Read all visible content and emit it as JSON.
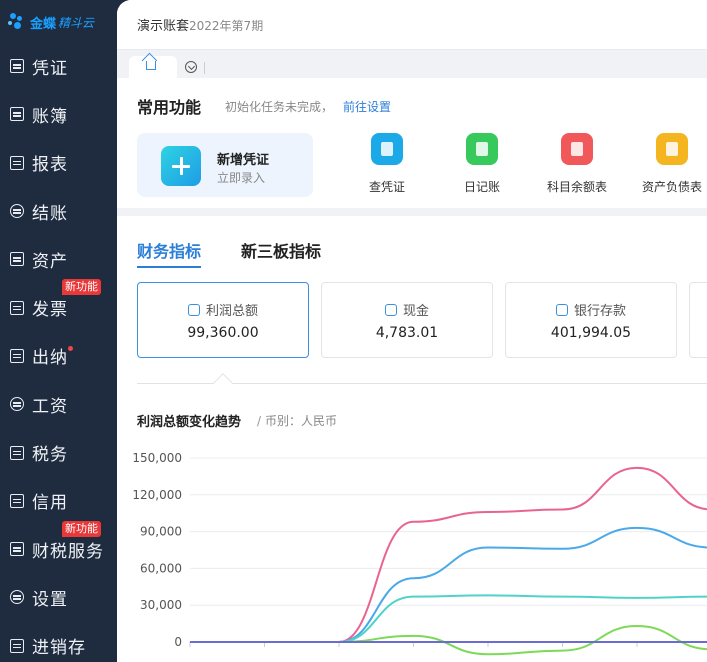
{
  "sidebar": {
    "logo_text": "金蝶",
    "logo_sub": "精斗云",
    "items": [
      {
        "label": "凭证",
        "icon": "voucher-icon"
      },
      {
        "label": "账簿",
        "icon": "ledger-icon"
      },
      {
        "label": "报表",
        "icon": "report-icon"
      },
      {
        "label": "结账",
        "icon": "closing-icon"
      },
      {
        "label": "资产",
        "icon": "asset-icon"
      },
      {
        "label": "发票",
        "icon": "invoice-icon",
        "badge": "新功能"
      },
      {
        "label": "出纳",
        "icon": "cashier-icon",
        "dot": true
      },
      {
        "label": "工资",
        "icon": "salary-icon"
      },
      {
        "label": "税务",
        "icon": "tax-icon"
      },
      {
        "label": "信用",
        "icon": "credit-icon"
      },
      {
        "label": "财税服务",
        "icon": "service-icon",
        "badge": "新功能"
      },
      {
        "label": "设置",
        "icon": "settings-icon"
      },
      {
        "label": "进销存",
        "icon": "inventory-icon"
      }
    ]
  },
  "header": {
    "company": "演示账套",
    "period": "2022年第7期"
  },
  "common": {
    "title": "常用功能",
    "hint": "初始化任务未完成，",
    "link": "前往设置",
    "voucher_title": "新增凭证",
    "voucher_sub": "立即录入",
    "shortcuts": [
      {
        "label": "查凭证",
        "icon": "voucher-search-icon",
        "color": "#1ba9e8"
      },
      {
        "label": "日记账",
        "icon": "journal-icon",
        "color": "#38c95c"
      },
      {
        "label": "科目余额表",
        "icon": "balance-icon",
        "color": "#f0585a"
      },
      {
        "label": "资产负债表",
        "icon": "balance-sheet-icon",
        "color": "#f5b520"
      }
    ]
  },
  "fin_tabs": [
    "财务指标",
    "新三板指标"
  ],
  "metrics": [
    {
      "label": "利润总额",
      "value": "99,360.00"
    },
    {
      "label": "现金",
      "value": "4,783.01"
    },
    {
      "label": "银行存款",
      "value": "401,994.05"
    }
  ],
  "chart_title": "利润总额变化趋势",
  "chart_sub": "币别：人民币",
  "chart_data": {
    "type": "line",
    "title": "利润总额变化趋势",
    "ylim": [
      0,
      150000
    ],
    "y_ticks": [
      "150,000",
      "120,000",
      "90,000",
      "60,000",
      "30,000",
      "0"
    ],
    "grid": true,
    "x_points": 8,
    "series": [
      {
        "color": "#e8648f",
        "values": [
          0,
          0,
          0,
          98000,
          106000,
          108000,
          142000,
          108000
        ]
      },
      {
        "color": "#4aa9e8",
        "values": [
          0,
          0,
          0,
          52000,
          77000,
          76000,
          93000,
          77000
        ]
      },
      {
        "color": "#4fd3c9",
        "values": [
          0,
          0,
          0,
          37000,
          38000,
          37000,
          36000,
          37000
        ]
      },
      {
        "color": "#7ed957",
        "values": [
          0,
          0,
          0,
          5000,
          -10000,
          -7000,
          13000,
          -6000
        ]
      },
      {
        "color": "#6b6bd1",
        "values": [
          0,
          0,
          0,
          0,
          0,
          0,
          0,
          0
        ]
      }
    ]
  }
}
